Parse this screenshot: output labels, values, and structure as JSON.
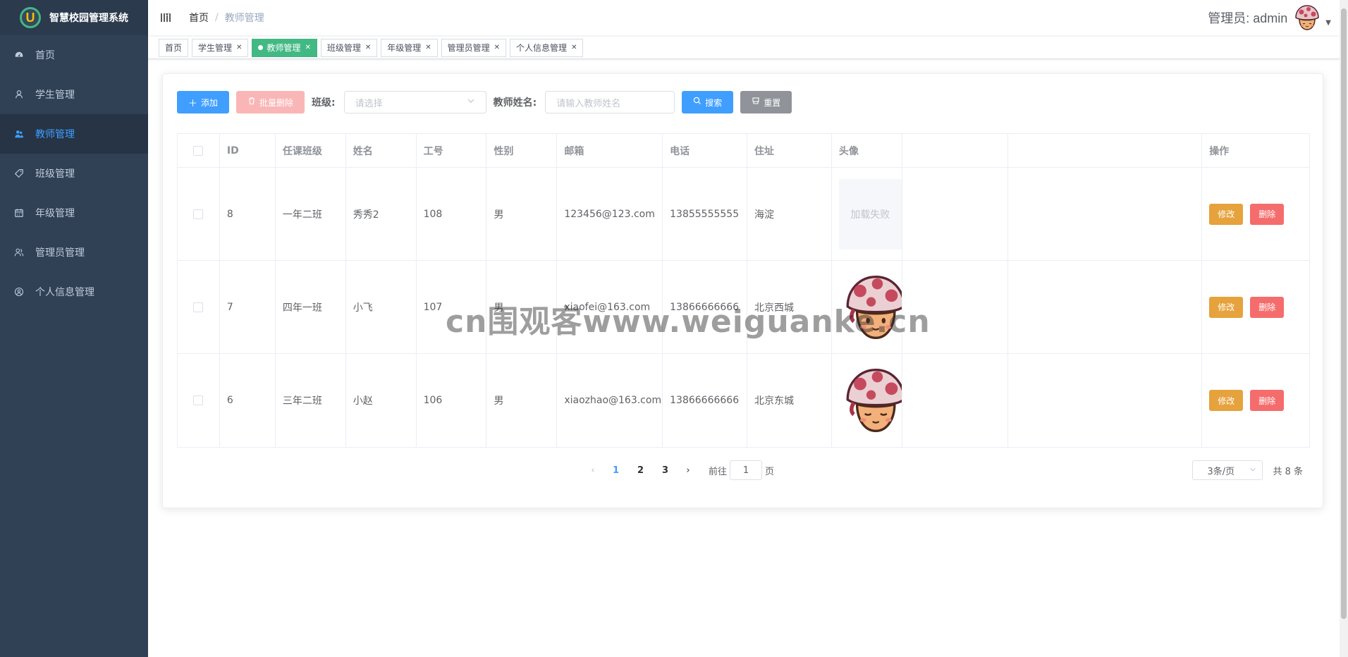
{
  "app": {
    "title": "智慧校园管理系统",
    "logo_letter": "U"
  },
  "sidebar": {
    "items": [
      {
        "label": "首页",
        "icon": "dashboard-icon",
        "active": false
      },
      {
        "label": "学生管理",
        "icon": "user-icon",
        "active": false
      },
      {
        "label": "教师管理",
        "icon": "peoples-icon",
        "active": true
      },
      {
        "label": "班级管理",
        "icon": "tag-icon",
        "active": false
      },
      {
        "label": "年级管理",
        "icon": "calendar-icon",
        "active": false
      },
      {
        "label": "管理员管理",
        "icon": "admin-icon",
        "active": false
      },
      {
        "label": "个人信息管理",
        "icon": "profile-icon",
        "active": false
      }
    ]
  },
  "navbar": {
    "breadcrumb": [
      "首页",
      "教师管理"
    ],
    "admin_label": "管理员: admin"
  },
  "tags": [
    {
      "label": "首页",
      "active": false,
      "closable": false
    },
    {
      "label": "学生管理",
      "active": false,
      "closable": true
    },
    {
      "label": "教师管理",
      "active": true,
      "closable": true
    },
    {
      "label": "班级管理",
      "active": false,
      "closable": true
    },
    {
      "label": "年级管理",
      "active": false,
      "closable": true
    },
    {
      "label": "管理员管理",
      "active": false,
      "closable": true
    },
    {
      "label": "个人信息管理",
      "active": false,
      "closable": true
    }
  ],
  "toolbar": {
    "add_label": "添加",
    "batch_delete_label": "批量删除",
    "class_label": "班级:",
    "class_placeholder": "请选择",
    "teacher_name_label": "教师姓名:",
    "teacher_name_placeholder": "请输入教师姓名",
    "search_label": "搜索",
    "reset_label": "重置"
  },
  "table": {
    "headers": {
      "id": "ID",
      "cls": "任课班级",
      "name": "姓名",
      "no": "工号",
      "sex": "性别",
      "mail": "邮箱",
      "phone": "电话",
      "addr": "住址",
      "ava": "头像",
      "op": "操作"
    },
    "rows": [
      {
        "id": "8",
        "cls": "一年二班",
        "name": "秀秀2",
        "no": "108",
        "sex": "男",
        "mail": "123456@123.com",
        "phone": "13855555555",
        "addr": "海淀",
        "avatar": "failed",
        "avatar_fail_text": "加载失败"
      },
      {
        "id": "7",
        "cls": "四年一班",
        "name": "小飞",
        "no": "107",
        "sex": "男",
        "mail": "xiaofei@163.com",
        "phone": "13866666666",
        "addr": "北京西城",
        "avatar": "mushroom"
      },
      {
        "id": "6",
        "cls": "三年二班",
        "name": "小赵",
        "no": "106",
        "sex": "男",
        "mail": "xiaozhao@163.com",
        "phone": "13866666666",
        "addr": "北京东城",
        "avatar": "mushroom"
      }
    ],
    "edit_label": "修改",
    "delete_label": "删除"
  },
  "pagination": {
    "pages": [
      "1",
      "2",
      "3"
    ],
    "current": "1",
    "goto_prefix": "前往",
    "goto_value": "1",
    "goto_suffix": "页",
    "page_size": "3条/页",
    "total": "共 8 条"
  },
  "watermark": "cn围观客www.weiguanke.cn",
  "colors": {
    "sidebar_bg": "#304156",
    "sidebar_active_text": "#409eff",
    "tag_active": "#42b983",
    "primary": "#409eff",
    "warning": "#e6a23c",
    "danger": "#f56c6c",
    "info": "#909399"
  }
}
